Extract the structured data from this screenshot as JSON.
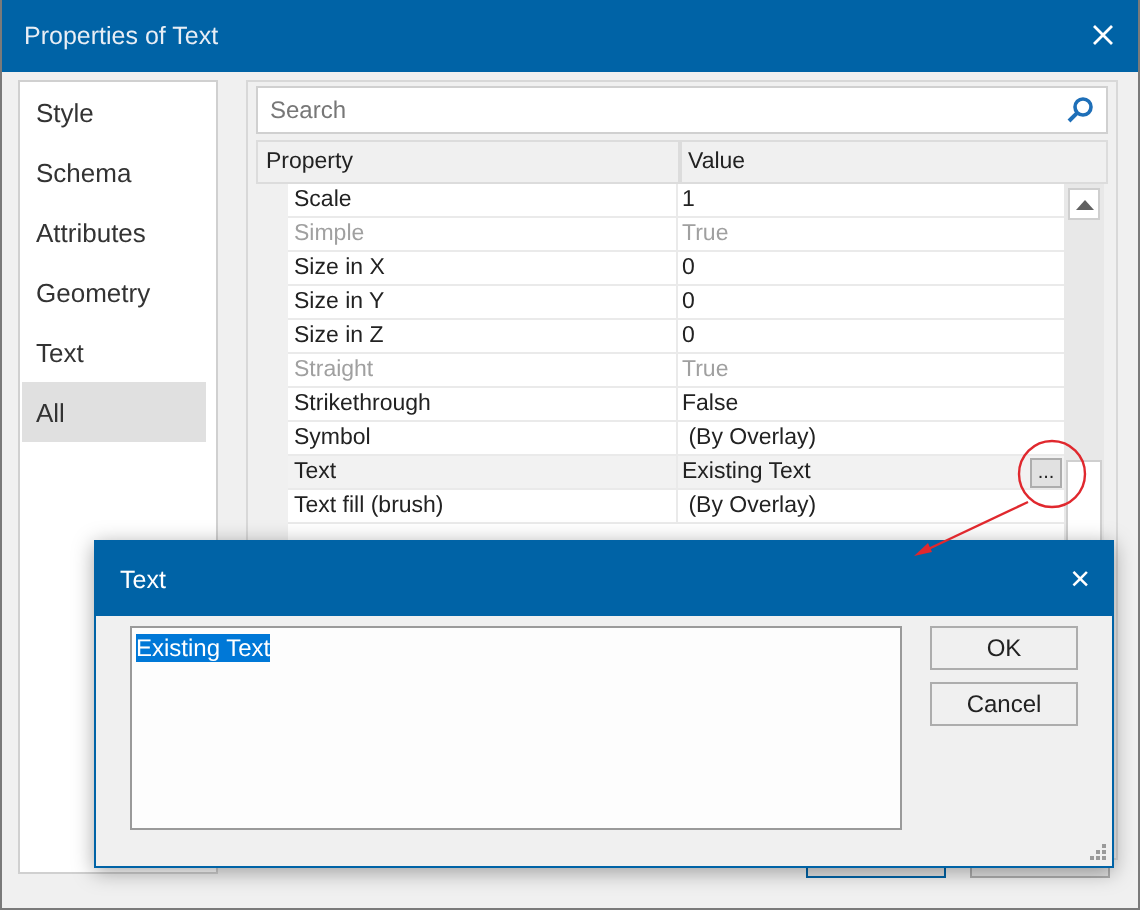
{
  "window": {
    "title": "Properties of Text"
  },
  "sidebar": {
    "items": [
      {
        "label": "Style",
        "selected": false
      },
      {
        "label": "Schema",
        "selected": false
      },
      {
        "label": "Attributes",
        "selected": false
      },
      {
        "label": "Geometry",
        "selected": false
      },
      {
        "label": "Text",
        "selected": false
      },
      {
        "label": "All",
        "selected": true
      }
    ]
  },
  "search": {
    "placeholder": "Search"
  },
  "grid": {
    "columns": [
      "Property",
      "Value"
    ],
    "rows": [
      {
        "property": "Scale",
        "value": "1",
        "disabled": false,
        "selected": false
      },
      {
        "property": "Simple",
        "value": "True",
        "disabled": true,
        "selected": false
      },
      {
        "property": "Size in X",
        "value": "0",
        "disabled": false,
        "selected": false
      },
      {
        "property": "Size in Y",
        "value": "0",
        "disabled": false,
        "selected": false
      },
      {
        "property": "Size in Z",
        "value": "0",
        "disabled": false,
        "selected": false
      },
      {
        "property": "Straight",
        "value": "True",
        "disabled": true,
        "selected": false
      },
      {
        "property": "Strikethrough",
        "value": "False",
        "disabled": false,
        "selected": false
      },
      {
        "property": "Symbol",
        "value": " (By Overlay)",
        "disabled": false,
        "selected": false
      },
      {
        "property": "Text",
        "value": "Existing Text",
        "disabled": false,
        "selected": true,
        "button": "..."
      },
      {
        "property": "Text fill (brush)",
        "value": " (By Overlay)",
        "disabled": false,
        "selected": false
      }
    ]
  },
  "dialog": {
    "title": "Text",
    "close": "×",
    "text": "Existing Text",
    "text_selected": true,
    "buttons": [
      "OK",
      "Cancel"
    ]
  }
}
